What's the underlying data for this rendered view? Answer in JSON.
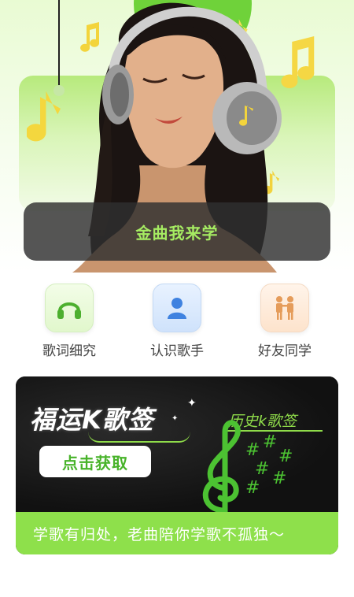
{
  "hero": {
    "banner_text": "金曲我来学",
    "colors": {
      "accent_green": "#6fd23a",
      "banner_text": "#a6ec62"
    }
  },
  "menu": {
    "items": [
      {
        "label": "歌词细究",
        "icon": "headphones-icon",
        "color": "#4caf2e"
      },
      {
        "label": "认识歌手",
        "icon": "person-icon",
        "color": "#3f82e0"
      },
      {
        "label": "好友同学",
        "icon": "friends-icon",
        "color": "#e59c5a"
      }
    ]
  },
  "promo": {
    "title": "福运K歌签",
    "button_label": "点击获取",
    "history_label": "历史k歌签",
    "footer_text": "学歌有归处，老曲陪你学歌不孤独～",
    "colors": {
      "footer_bg": "#8ee04b",
      "accent": "#8fdc4a"
    }
  }
}
